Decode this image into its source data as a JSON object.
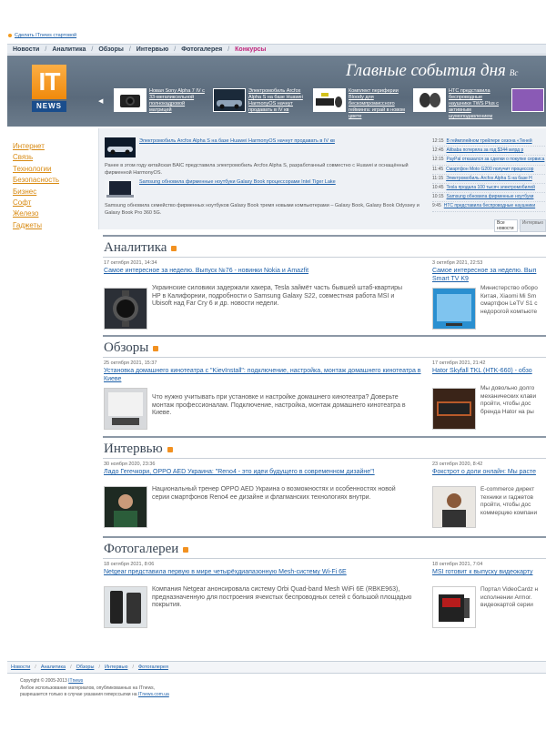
{
  "top": {
    "make_home": "Сделать ITnews стартовой"
  },
  "nav": {
    "items": [
      {
        "label": "Новости"
      },
      {
        "label": "Аналитика"
      },
      {
        "label": "Обзоры"
      },
      {
        "label": "Интервью"
      },
      {
        "label": "Фотогалерея"
      },
      {
        "label": "Конкурсы"
      }
    ]
  },
  "header": {
    "logo_top": "IT",
    "logo_bottom": "NEWS",
    "title": "Главные события дня",
    "title_cut": "Вс"
  },
  "slider": [
    {
      "caption": "Новая Sony Alpha 7 IV с 33-мегапиксельной полнокадровой матрицей"
    },
    {
      "caption": "Электромобиль Arcfox Alpha S на базе Huawei HarmonyOS начнут продавать в IV кв"
    },
    {
      "caption": "Комплект периферии Bloody для бескомпромиссного гейминга: играй в новом цвете"
    },
    {
      "caption": "HTC представила беспроводные наушники TWS Plus с активным шумоподавлением"
    }
  ],
  "sidebar": {
    "items": [
      "Интернет",
      "Связь",
      "Технологии",
      "Безопасность",
      "Бизнес",
      "Софт",
      "Железо",
      "Гаджеты"
    ]
  },
  "feed": {
    "items": [
      {
        "title": "Электромобиль Arcfox Alpha S на базе Huawei HarmonyOS начнут продавать в IV кв",
        "text": "Ранее в этом году китайская BAIC представила электромобиль Arcfox Alpha S, разработанный совместно с Huawei и оснащённый фирменной HarmonyOS."
      },
      {
        "title": "Samsung обновила фирменные ноутбуки Galaxy Book процессорами Intel Tiger Lake",
        "text": "Samsung обновила семейство фирменных ноутбуков Galaxy Book тремя новыми компьютерами – Galaxy Book, Galaxy Book Odyssey и Galaxy Book Pro 360 5G."
      }
    ],
    "ticker": [
      {
        "time": "12:15",
        "text": "В геймплейном трейлере сезона «Теней"
      },
      {
        "time": "12:45",
        "text": "Alibaba потеряла за год $344 млрд р"
      },
      {
        "time": "12:15",
        "text": "PayPal отказался за сделки о покупке сервиса"
      },
      {
        "time": "11:45",
        "text": "Смартфон Moto G200 получит процессор"
      },
      {
        "time": "11:15",
        "text": "Электромобиль Arcfox Alpha S на базе H"
      },
      {
        "time": "10:45",
        "text": "Tesla продала 100 тысяч электромобилей"
      },
      {
        "time": "10:15",
        "text": "Samsung обновила фирменные ноутбуки"
      },
      {
        "time": "9:45",
        "text": "HTC представила беспроводные наушники"
      }
    ],
    "tabs": [
      "Все новости",
      "Интервью"
    ]
  },
  "sections": [
    {
      "title": "Аналитика",
      "articles": [
        {
          "date": "17 октября 2021, 14:34",
          "title": "Самое интересное за неделю. Выпуск №76 - новинки Nokia и Amazfit",
          "text": "Украинские силовики задержали хакера, Tesla займёт часть бывшей штаб-квартиры HP в Калифорнии, подробности о Samsung Galaxy S22, совместная работа MSI и Ubisoft над Far Cry 6 и др. новости недели."
        },
        {
          "date": "3 октября 2021, 22:53",
          "title": "Самое интересное за неделю. Вып Smart TV K9",
          "text": "Министерство оборо Китая, Xiaomi Mi Sm смартфон LeTV S1 с недорогой компьюте"
        }
      ]
    },
    {
      "title": "Обзоры",
      "articles": [
        {
          "date": "25 октября 2021, 15:37",
          "title": "Установка домашнего кинотеатра с \"KievInstall\": подключение, настройка, монтаж домашнего кинотеатра в Киеве",
          "text": "Что нужно учитывать при установке и настройке домашнего кинотеатра? Доверьте монтаж профессионалам. Подключение, настройка, монтаж домашнего кинотеатра в Киеве."
        },
        {
          "date": "17 октября 2021, 21:42",
          "title": "Hator Skyfall TKL (HTK-660) - обзо",
          "text": "Мы довольно долго механических клави пройти, чтобы дос бренда Hator на ры"
        }
      ]
    },
    {
      "title": "Интервью",
      "articles": [
        {
          "date": "30 ноября 2020, 23:36",
          "title": "Ладо Гегечкори, OPPO AED Украина: \"Reno4 - это идеи будущего в современном дизайне\"!",
          "text": "Национальный тренер OPPO AED Украина о возможностях и особенностях новой серии смартфонов Reno4 ее дизайне и флагманских технологиях внутри."
        },
        {
          "date": "23 октября 2020, 8:42",
          "title": "Фокстрот о доли онлайн: Мы расте",
          "text": "E-commerce директ техники и гаджетов пройти, чтобы дос коммерцию компани"
        }
      ]
    },
    {
      "title": "Фотогалереи",
      "articles": [
        {
          "date": "18 октября 2021, 8:06",
          "title": "Netgear представила первую в мире четырёхдиапазонную Mesh-систему Wi-Fi 6E",
          "text": "Компания Netgear анонсировала систему Orbi Quad-band Mesh WiFi 6E (RBKE963), предназначенную для построения ячеистых беспроводных сетей с большой площадью покрытия."
        },
        {
          "date": "18 октября 2021, 7:04",
          "title": "MSI готовит к выпуску видеокарту",
          "text": "Портал VideoCardz н исполнении Armor. видеокартой серии"
        }
      ]
    }
  ],
  "footer": {
    "nav": [
      "Новости",
      "Аналитика",
      "Обзоры",
      "Интервью",
      "Фотогалерея"
    ],
    "copyright": "Copyright © 2005-2013",
    "copyright_link": "ITnews",
    "line2": "Любое использование материалов, опубликованных на ITnews,",
    "line3": "разрешается только в случае указания гиперссылки на",
    "line3_link": "ITnews.com.ua"
  },
  "colors": {
    "accent_orange": "#f08a0c",
    "link_blue": "#1c5fa8",
    "nav_highlight": "#c0247a",
    "header_bg": "#5a6a7b"
  }
}
